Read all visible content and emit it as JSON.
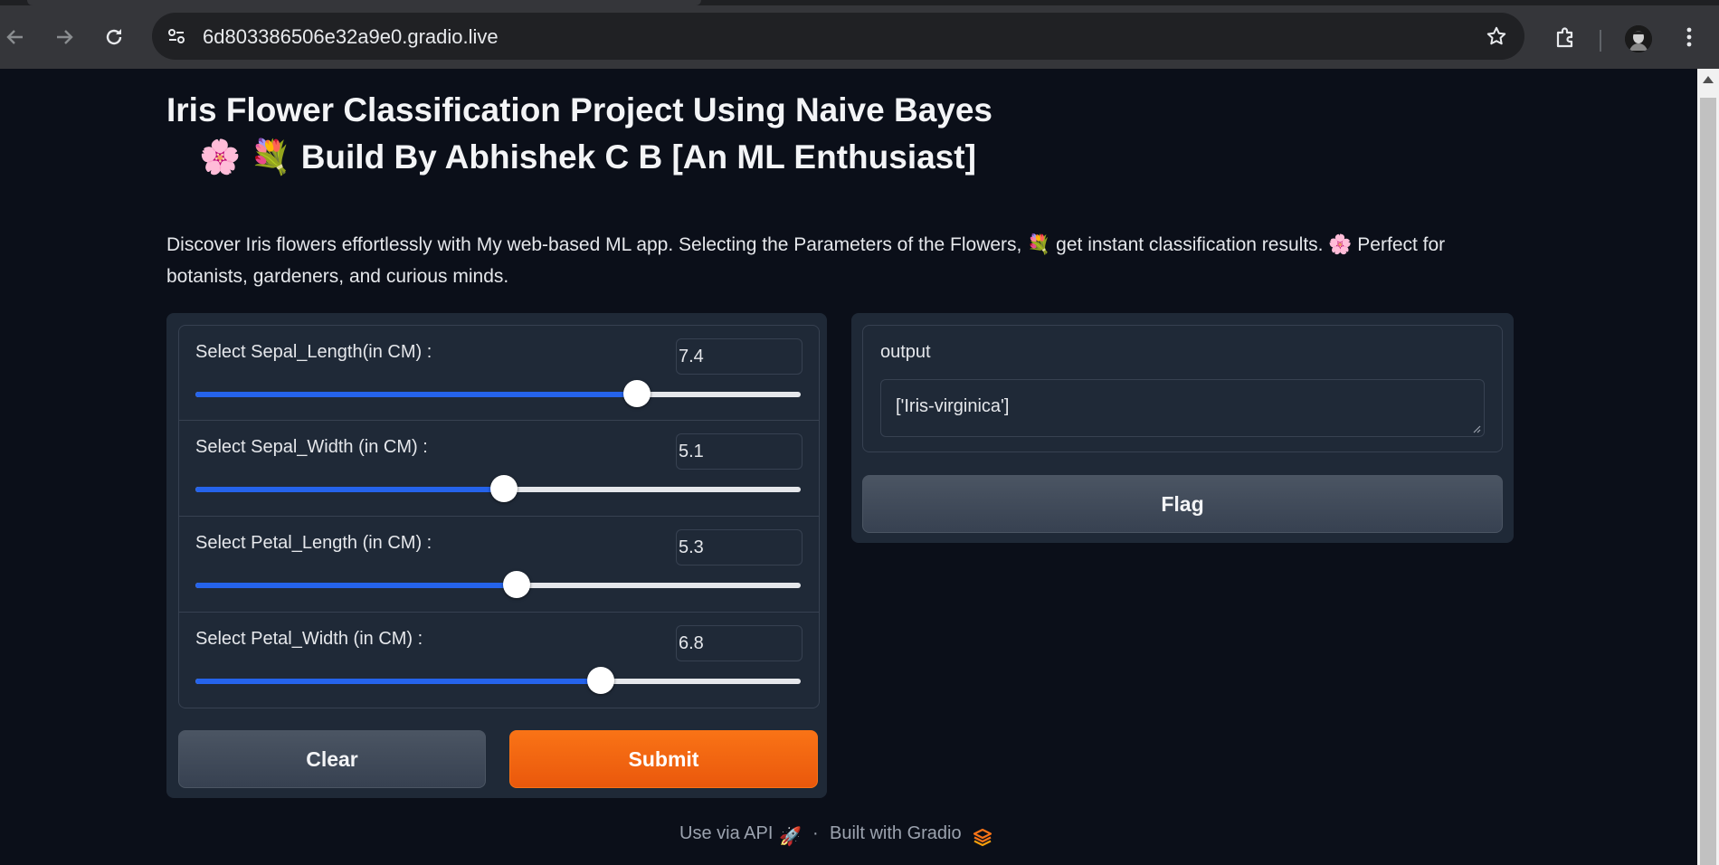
{
  "browser": {
    "url": "6d803386506e32a9e0.gradio.live"
  },
  "app": {
    "title_line1": "Iris Flower Classification Project Using Naive Bayes",
    "title_line2": "🌸 💐 Build By Abhishek C B [An ML Enthusiast]",
    "description": "Discover Iris flowers effortlessly with My web-based ML app. Selecting the Parameters of the Flowers, 💐 get instant classification results. 🌸 Perfect for botanists, gardeners, and curious minds."
  },
  "inputs": {
    "sliders": [
      {
        "label": "Select Sepal_Length(in CM) :",
        "value": "7.4",
        "fraction": 0.73
      },
      {
        "label": "Select Sepal_Width (in CM) :",
        "value": "5.1",
        "fraction": 0.51
      },
      {
        "label": "Select Petal_Length (in CM) :",
        "value": "5.3",
        "fraction": 0.53
      },
      {
        "label": "Select Petal_Width (in CM) :",
        "value": "6.8",
        "fraction": 0.67
      }
    ],
    "clear_label": "Clear",
    "submit_label": "Submit"
  },
  "output": {
    "label": "output",
    "value": "['Iris-virginica']",
    "flag_label": "Flag"
  },
  "footer": {
    "api_label": "Use via API",
    "separator": "·",
    "built_label": "Built with Gradio"
  },
  "colors": {
    "accent": "#2563eb",
    "primary_button": "#f97316",
    "background": "#0b0f19",
    "panel": "#1f2937"
  }
}
